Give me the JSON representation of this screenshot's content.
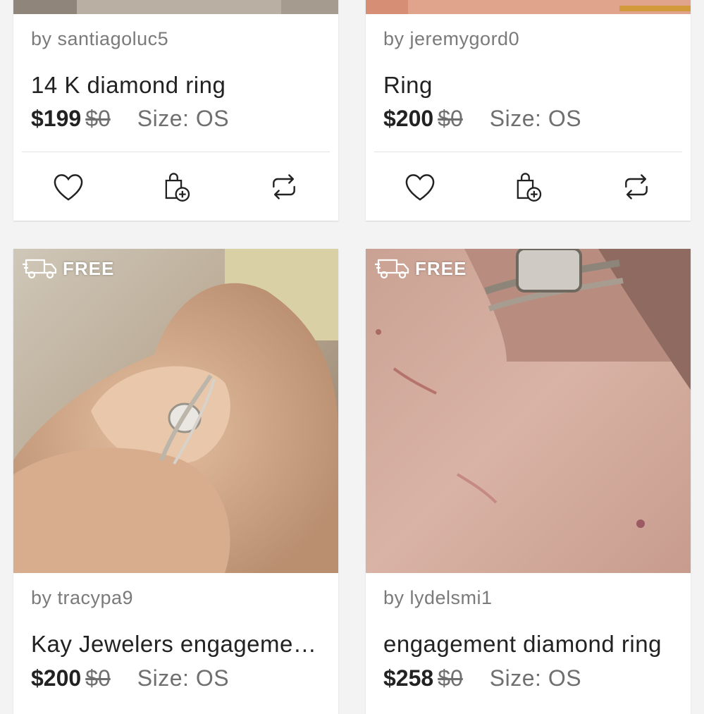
{
  "listings": [
    {
      "seller": "by santiagoluc5",
      "title": "14 K diamond ring",
      "price": "$199",
      "original_price": "$0",
      "size": "Size: OS"
    },
    {
      "seller": "by jeremygord0",
      "title": "Ring",
      "price": "$200",
      "original_price": "$0",
      "size": "Size: OS"
    },
    {
      "seller": "by tracypa9",
      "title": "Kay Jewelers engagement ring",
      "price": "$200",
      "original_price": "$0",
      "size": "Size: OS",
      "badge": "FREE"
    },
    {
      "seller": "by lydelsmi1",
      "title": "engagement diamond ring",
      "price": "$258",
      "original_price": "$0",
      "size": "Size: OS",
      "badge": "FREE"
    }
  ],
  "icons": {
    "like": "heart-icon",
    "add_to_bundle": "bag-plus-icon",
    "share": "share-icon",
    "shipping": "truck-icon"
  },
  "colors": {
    "background": "#f3f3f3",
    "card": "#ffffff",
    "text": "#222222",
    "muted": "#7a7a7a"
  }
}
